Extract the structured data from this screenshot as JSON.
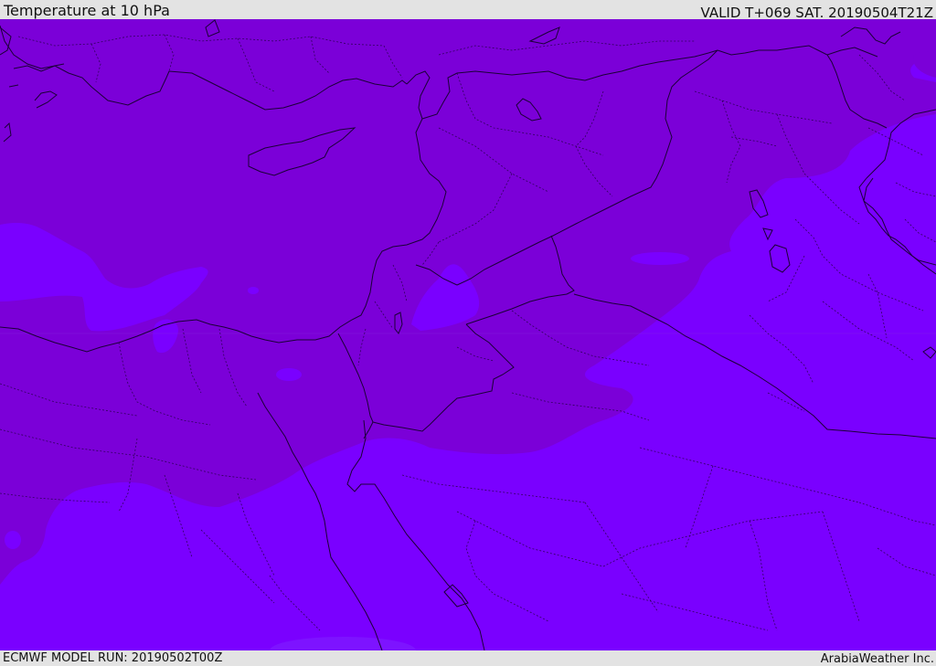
{
  "header": {
    "title": "Temperature at 10 hPa",
    "valid": "VALID T+069 SAT. 20190504T21Z"
  },
  "footer": {
    "model_run": "ECMWF MODEL RUN: 20190502T00Z",
    "credit": "ArabiaWeather Inc."
  },
  "colors": {
    "band_warm": "#7b00d8",
    "band_cool": "#7a00ff",
    "coast": "#1c0038",
    "border": "#2a0050"
  }
}
